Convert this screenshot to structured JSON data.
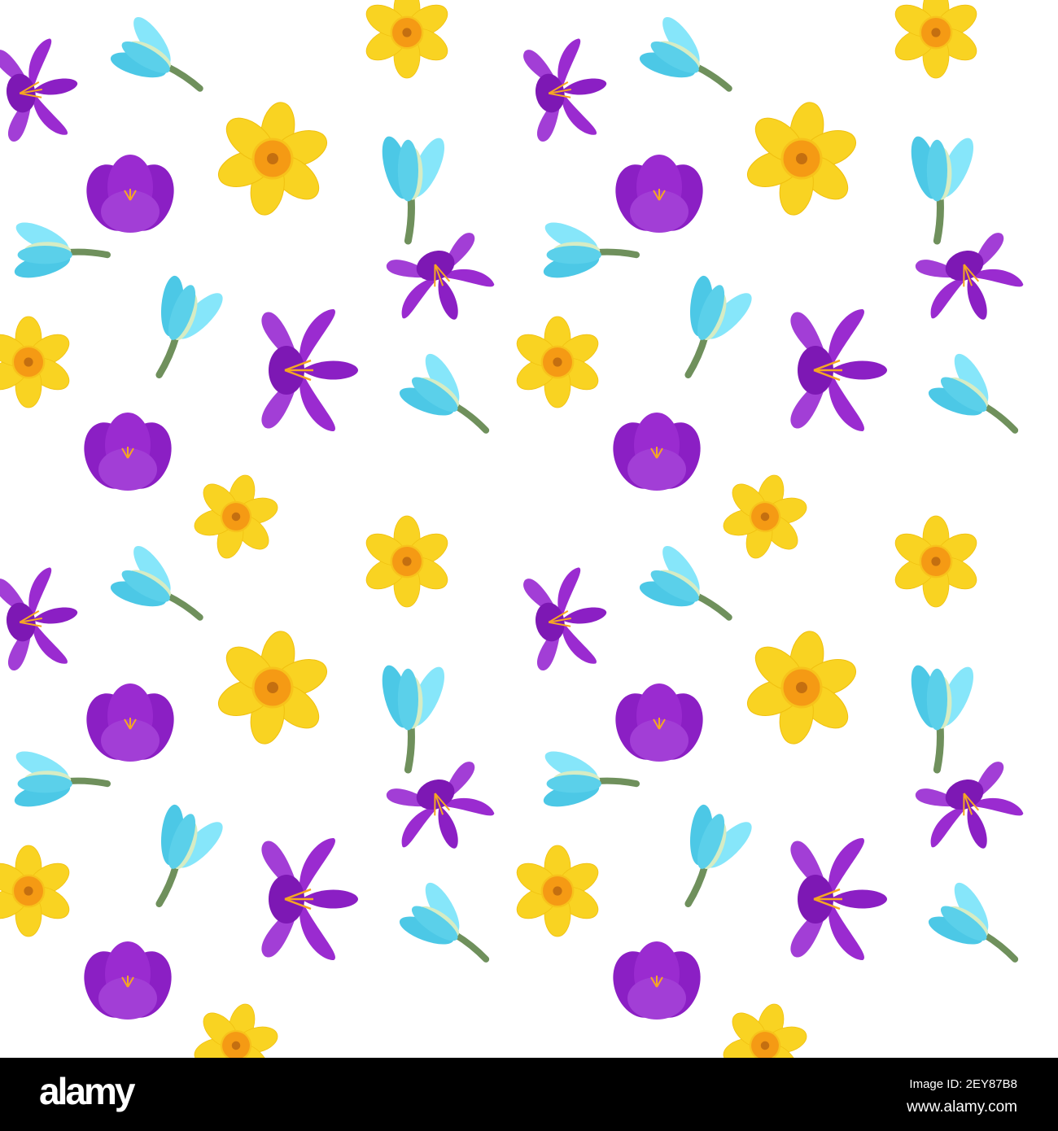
{
  "colors": {
    "purple": "#8b1fc4",
    "purple_light": "#a23ed6",
    "yellow": "#f9d322",
    "yellow_dark": "#f0c010",
    "orange": "#f59a14",
    "blue": "#4cc8e6",
    "blue_light": "#86e6fa",
    "stem": "#6f905c"
  },
  "footer": {
    "logo": "alamy",
    "image_id": "Image ID: 2EY87B8",
    "site": "www.alamy.com"
  }
}
